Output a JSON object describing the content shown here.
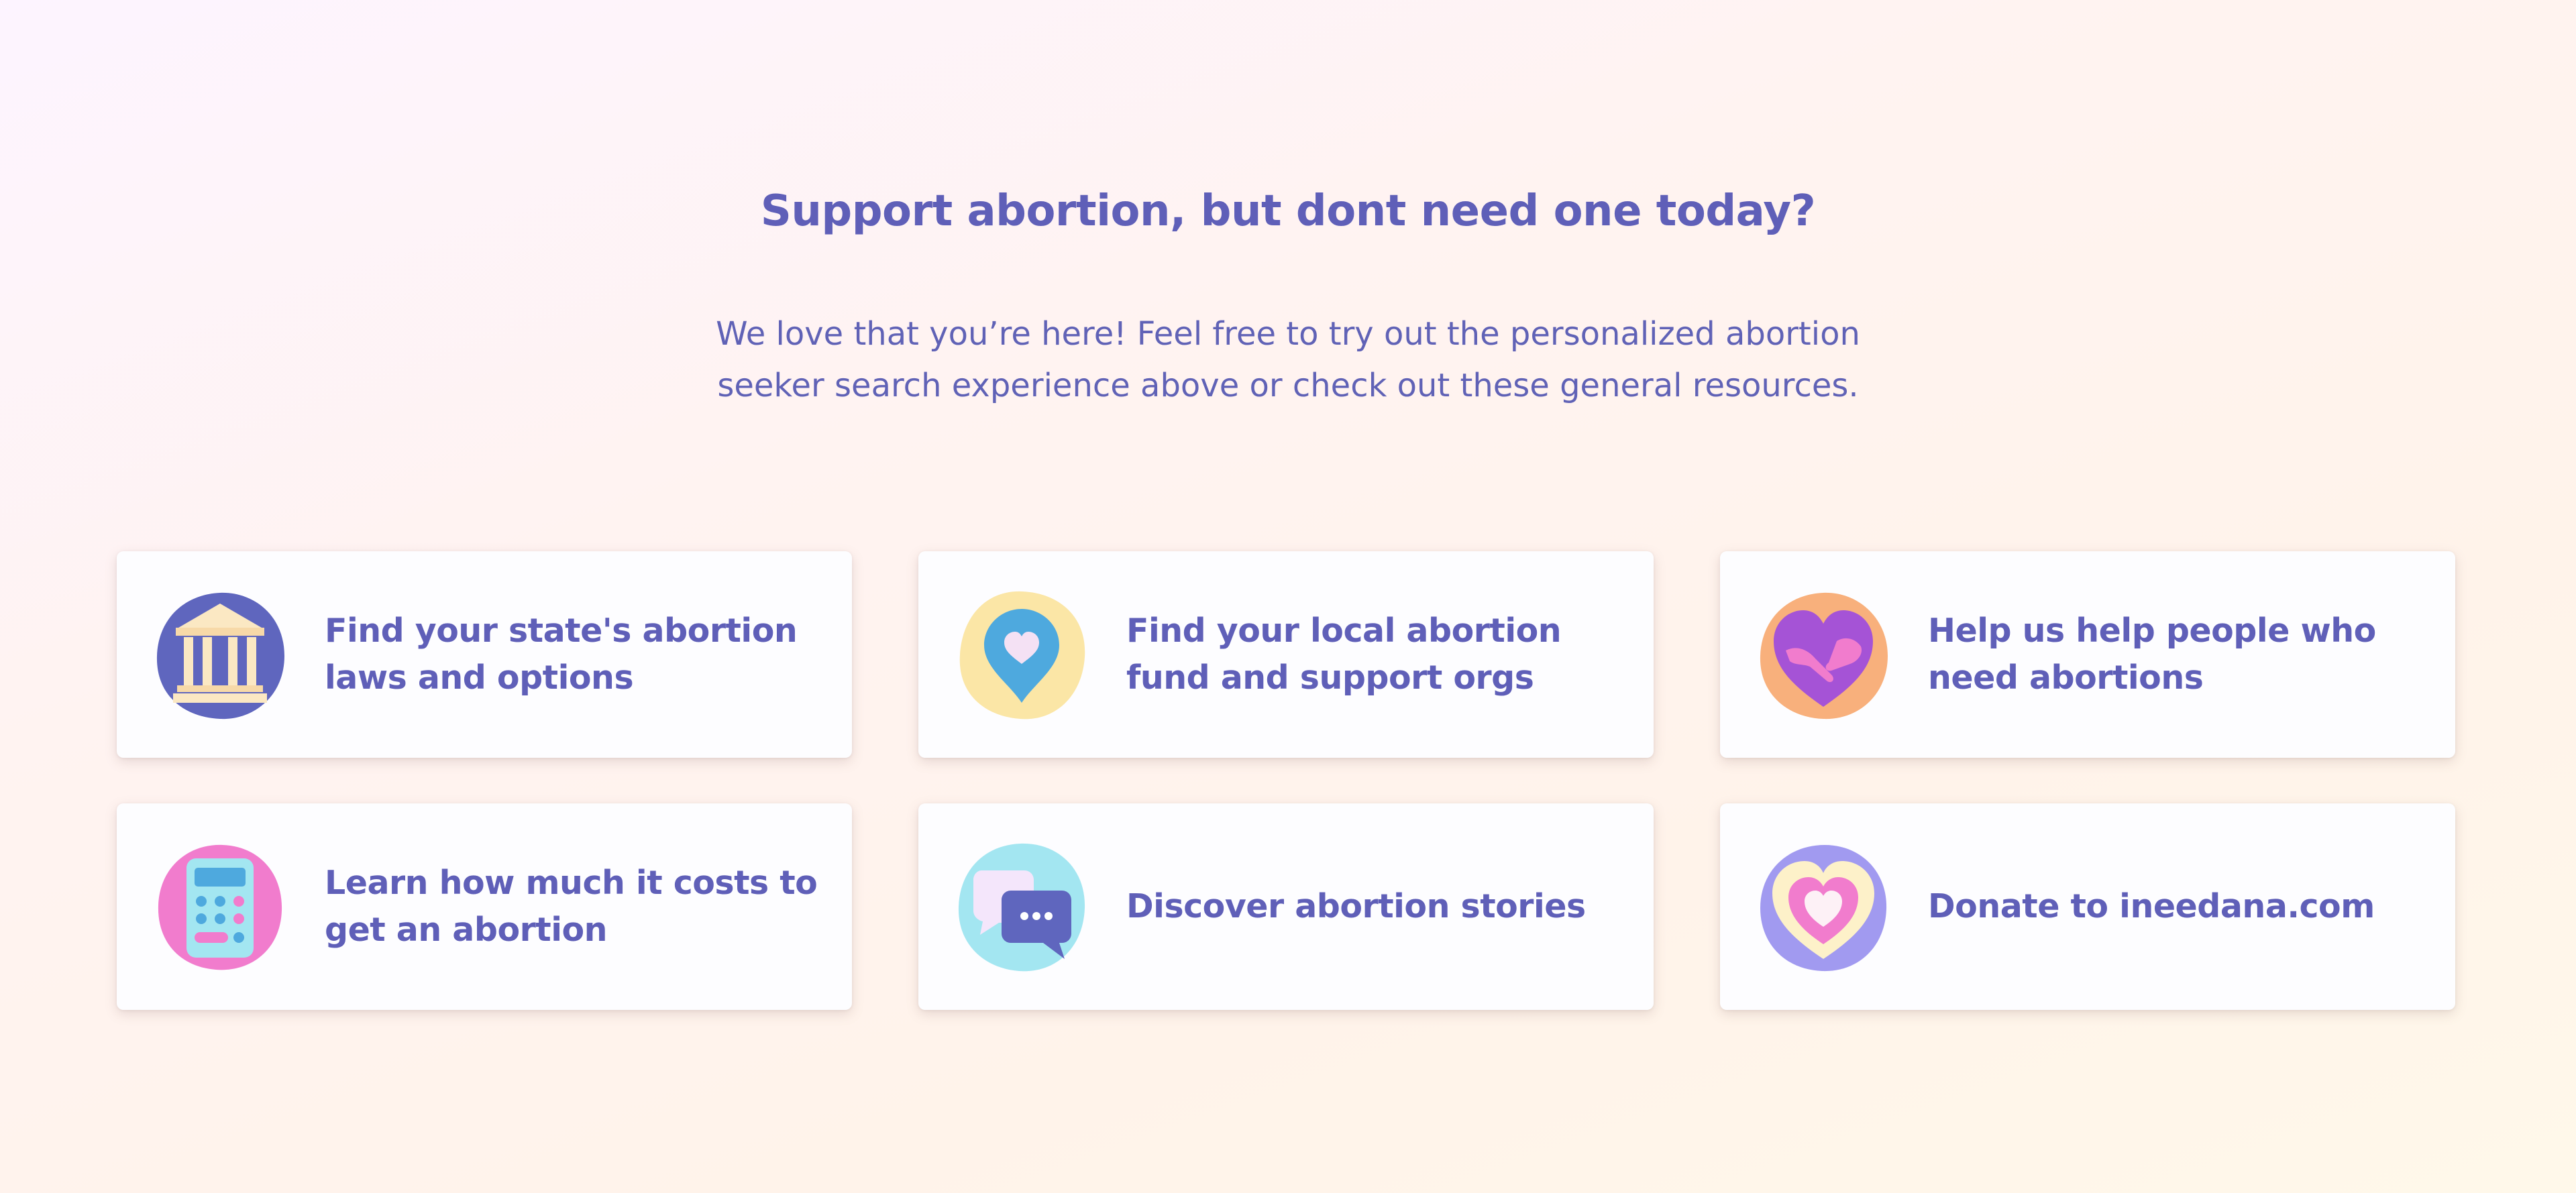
{
  "section": {
    "heading": "Support abortion, but dont need one today?",
    "intro": "We love that you’re here! Feel free to try out the personalized abortion seeker search experience above or check out these general resources."
  },
  "resources": [
    {
      "label": "Find your state's abortion laws and options",
      "icon": "courthouse-icon",
      "blob_color": "#5f66be"
    },
    {
      "label": "Find your local abortion fund and support orgs",
      "icon": "heart-map-pin-icon",
      "blob_color": "#fbe6a6"
    },
    {
      "label": "Help us help people who need abortions",
      "icon": "heart-hands-icon",
      "blob_color": "#f8b07c"
    },
    {
      "label": "Learn how much it costs to get an abortion",
      "icon": "calculator-icon",
      "blob_color": "#f17ccd"
    },
    {
      "label": "Discover abortion stories",
      "icon": "chat-bubbles-icon",
      "blob_color": "#a3e6f1"
    },
    {
      "label": "Donate to ineedana.com",
      "icon": "heart-icon",
      "blob_color": "#a19af0"
    }
  ]
}
